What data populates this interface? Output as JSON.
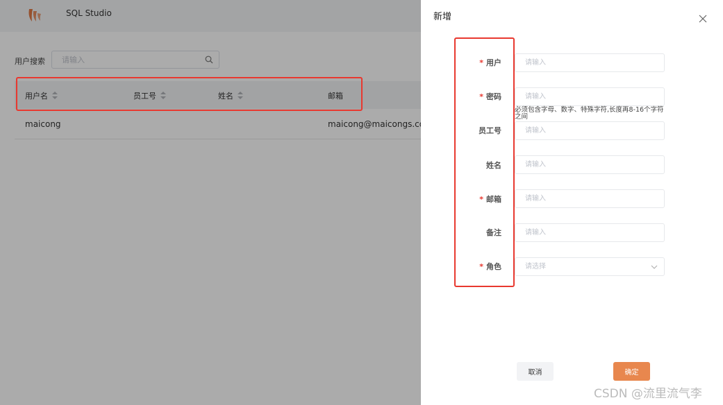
{
  "app": {
    "title": "SQL Studio"
  },
  "search": {
    "label": "用户搜索",
    "placeholder": "请输入"
  },
  "table": {
    "columns": [
      "用户名",
      "员工号",
      "姓名",
      "邮箱"
    ],
    "rows": [
      {
        "username": "maicong",
        "employee_id": "",
        "name": "",
        "email": "maicong@maicongs.com"
      }
    ]
  },
  "drawer": {
    "title": "新增",
    "fields": [
      {
        "label": "用户",
        "required": true,
        "placeholder": "请输入"
      },
      {
        "label": "密码",
        "required": true,
        "placeholder": "请输入",
        "hint": "必须包含字母、数字、特殊字符,长度再8-16个字符之间"
      },
      {
        "label": "员工号",
        "required": false,
        "placeholder": "请输入"
      },
      {
        "label": "姓名",
        "required": false,
        "placeholder": "请输入"
      },
      {
        "label": "邮箱",
        "required": true,
        "placeholder": "请输入"
      },
      {
        "label": "备注",
        "required": false,
        "placeholder": "请输入"
      },
      {
        "label": "角色",
        "required": true,
        "placeholder": "请选择"
      }
    ],
    "required_mark": "*",
    "cancel_label": "取消",
    "ok_label": "确定"
  },
  "watermark": "CSDN @流里流气李",
  "colors": {
    "accent": "#e8874e",
    "highlight": "#e8382f",
    "logo": "#e07a45"
  }
}
